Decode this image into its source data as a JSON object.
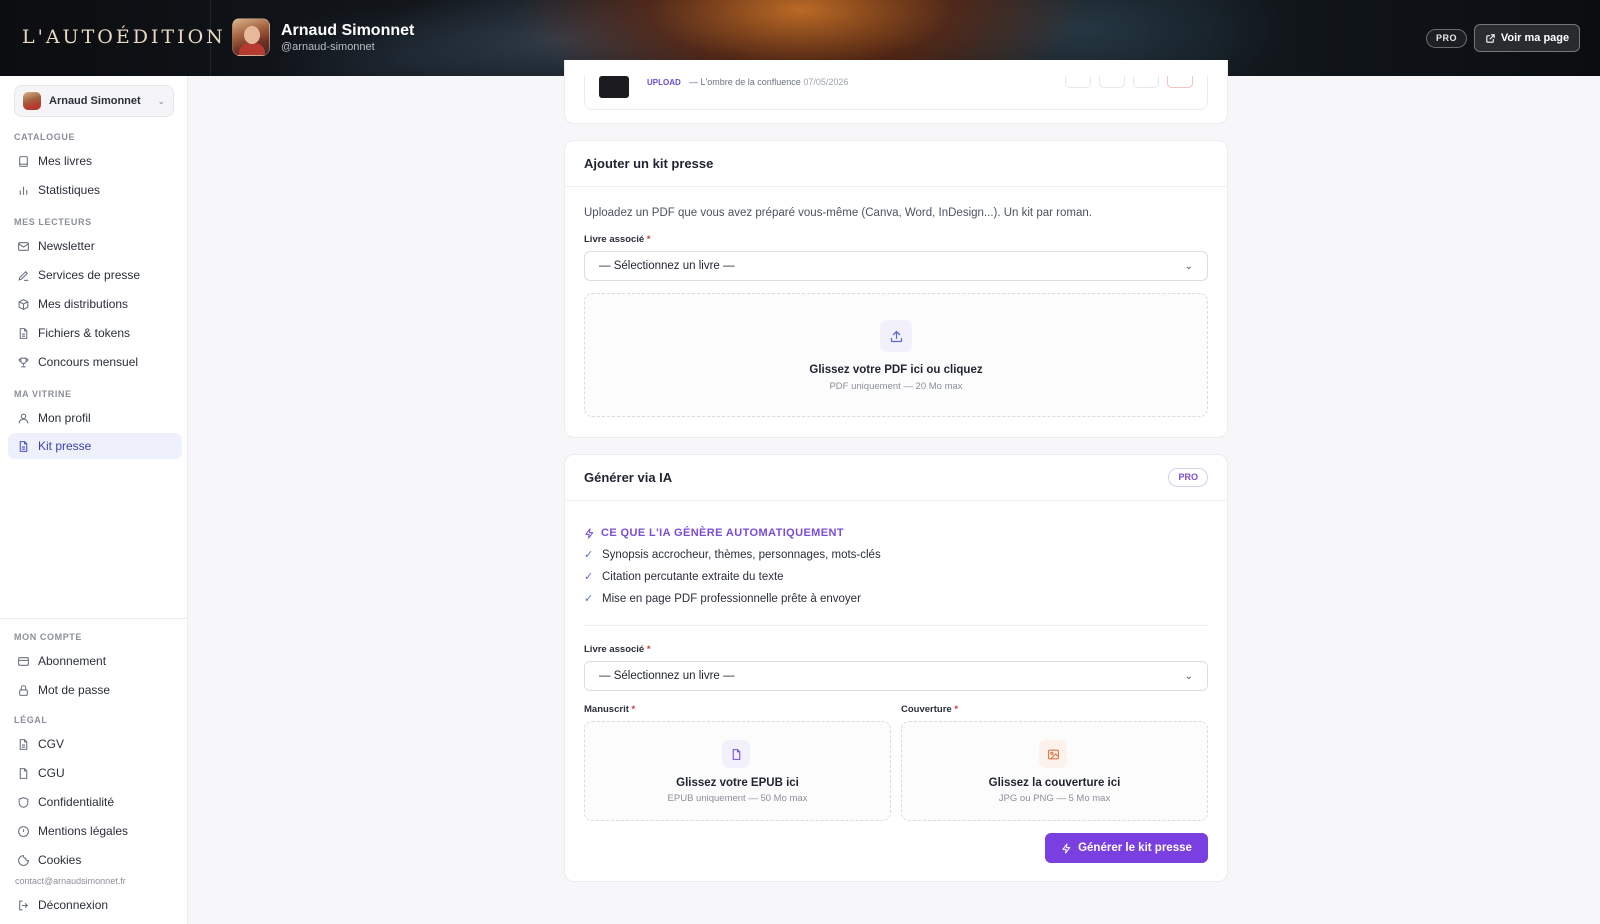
{
  "header": {
    "logo": "L'AUTOÉDITION",
    "user_name": "Arnaud Simonnet",
    "user_handle": "@arnaud-simonnet",
    "pro_badge": "PRO",
    "view_page": "Voir ma page"
  },
  "sidebar": {
    "account_name": "Arnaud Simonnet",
    "sections": {
      "catalogue": "CATALOGUE",
      "readers": "MES LECTEURS",
      "vitrine": "MA VITRINE",
      "account": "MON COMPTE",
      "legal": "LÉGAL"
    },
    "items": {
      "books": "Mes livres",
      "stats": "Statistiques",
      "newsletter": "Newsletter",
      "press": "Services de presse",
      "distributions": "Mes distributions",
      "files": "Fichiers & tokens",
      "contest": "Concours mensuel",
      "profile": "Mon profil",
      "presskit": "Kit presse",
      "subscription": "Abonnement",
      "password": "Mot de passe",
      "cgv": "CGV",
      "cgu": "CGU",
      "privacy": "Confidentialité",
      "legal": "Mentions légales",
      "cookies": "Cookies",
      "logout": "Déconnexion"
    },
    "contact": "contact@arnaudsimonnet.fr"
  },
  "top_row": {
    "tag": "UPLOAD",
    "title": "— L'ombre de la confluence",
    "date": "07/05/2026"
  },
  "upload_card": {
    "title": "Ajouter un kit presse",
    "description": "Uploadez un PDF que vous avez préparé vous-même (Canva, Word, InDesign...). Un kit par roman.",
    "book_label": "Livre associé",
    "book_placeholder": "— Sélectionnez un livre —",
    "drop_title": "Glissez votre PDF ici ou cliquez",
    "drop_sub": "PDF uniquement — 20 Mo max"
  },
  "ai_card": {
    "title": "Générer via IA",
    "pro": "PRO",
    "features_title": "CE QUE L'IA GÉNÈRE AUTOMATIQUEMENT",
    "features": [
      "Synopsis accrocheur, thèmes, personnages, mots-clés",
      "Citation percutante extraite du texte",
      "Mise en page PDF professionnelle prête à envoyer"
    ],
    "book_label": "Livre associé",
    "book_placeholder": "— Sélectionnez un livre —",
    "manuscript_label": "Manuscrit",
    "cover_label": "Couverture",
    "epub_title": "Glissez votre EPUB ici",
    "epub_sub": "EPUB uniquement — 50 Mo max",
    "cover_title": "Glissez la couverture ici",
    "cover_sub": "JPG ou PNG — 5 Mo max",
    "generate": "Générer le kit presse"
  },
  "icons": {
    "accent": "#7a3fe0",
    "active_nav": "#eef0fb"
  }
}
